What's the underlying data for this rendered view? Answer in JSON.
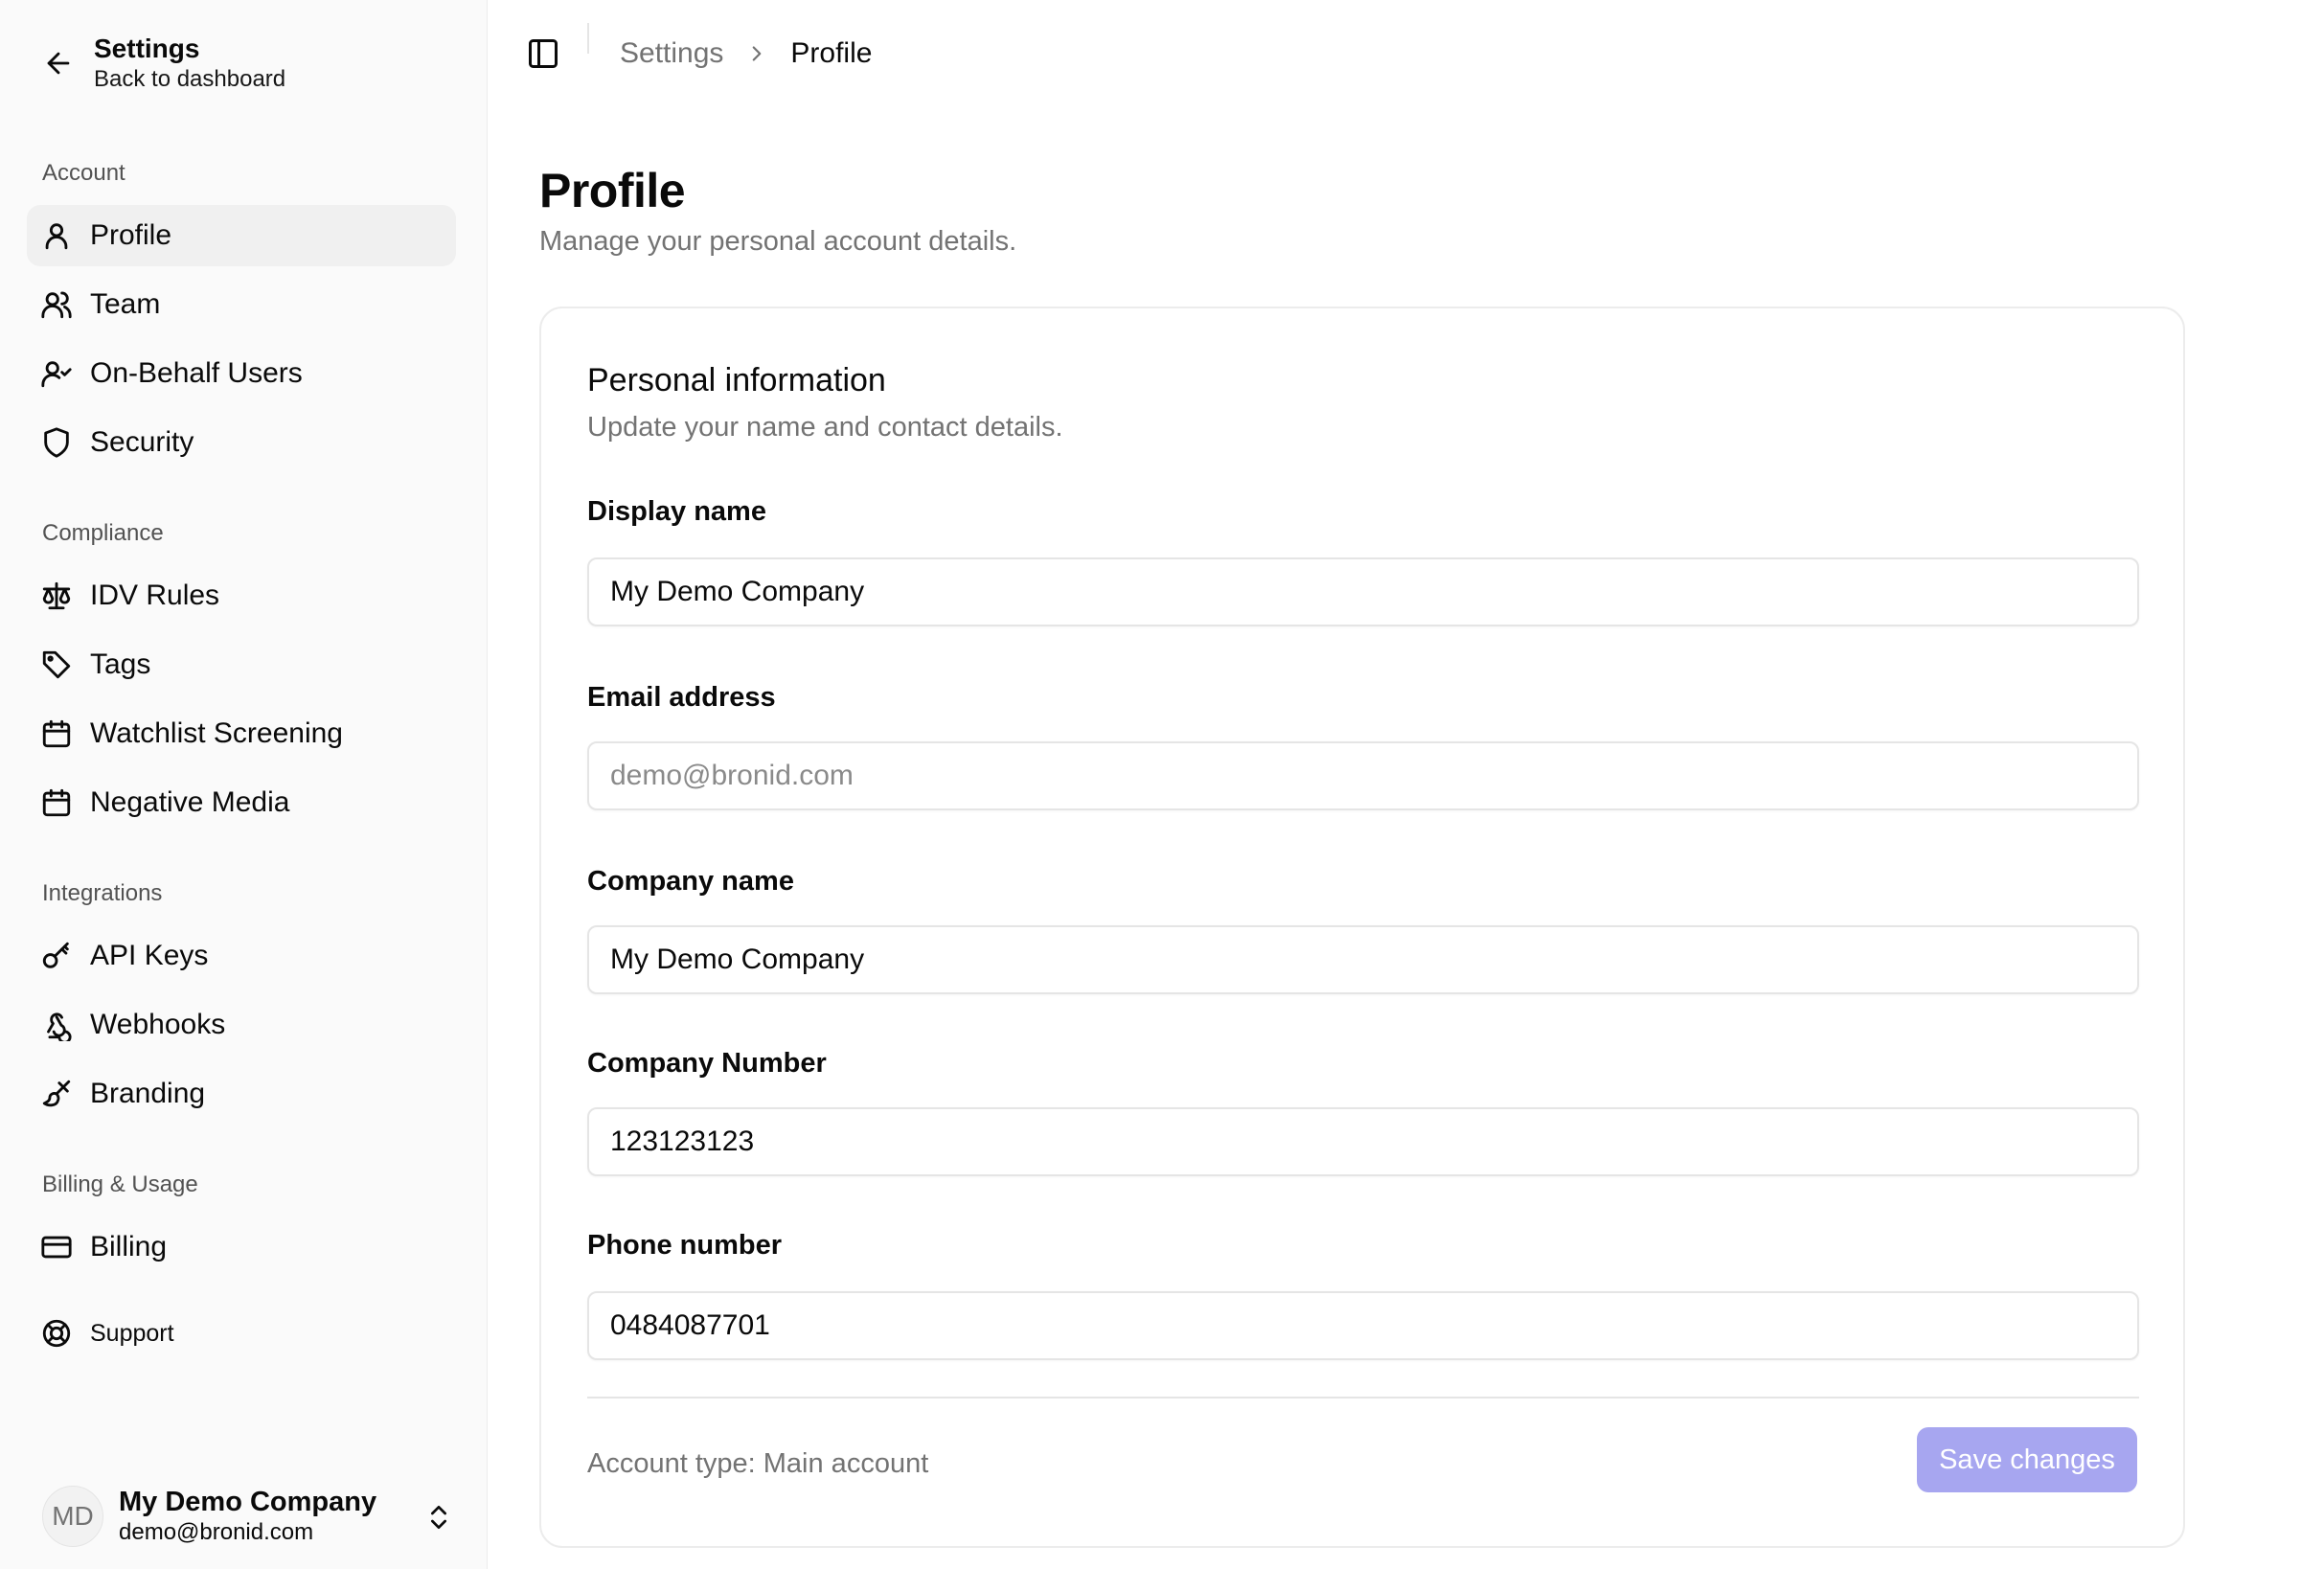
{
  "back": {
    "title": "Settings",
    "subtitle": "Back to dashboard"
  },
  "sidebar": {
    "groups": [
      {
        "label": "Account",
        "items": [
          {
            "label": "Profile",
            "icon": "user-icon"
          },
          {
            "label": "Team",
            "icon": "users-icon"
          },
          {
            "label": "On-Behalf Users",
            "icon": "user-check-icon"
          },
          {
            "label": "Security",
            "icon": "shield-icon"
          }
        ]
      },
      {
        "label": "Compliance",
        "items": [
          {
            "label": "IDV Rules",
            "icon": "scale-icon"
          },
          {
            "label": "Tags",
            "icon": "tag-icon"
          },
          {
            "label": "Watchlist Screening",
            "icon": "calendar-icon"
          },
          {
            "label": "Negative Media",
            "icon": "calendar-icon"
          }
        ]
      },
      {
        "label": "Integrations",
        "items": [
          {
            "label": "API Keys",
            "icon": "key-icon"
          },
          {
            "label": "Webhooks",
            "icon": "webhook-icon"
          },
          {
            "label": "Branding",
            "icon": "paintbrush-icon"
          }
        ]
      },
      {
        "label": "Billing & Usage",
        "items": [
          {
            "label": "Billing",
            "icon": "credit-card-icon"
          }
        ]
      }
    ],
    "support": {
      "label": "Support",
      "icon": "life-buoy-icon"
    },
    "active_item": "Profile"
  },
  "user": {
    "initials": "MD",
    "name": "My Demo Company",
    "email": "demo@bronid.com"
  },
  "breadcrumb": {
    "parent": "Settings",
    "current": "Profile"
  },
  "page": {
    "title": "Profile",
    "subtitle": "Manage your personal account details."
  },
  "card": {
    "title": "Personal information",
    "subtitle": "Update your name and contact details.",
    "fields": {
      "display_name": {
        "label": "Display name",
        "value": "My Demo Company"
      },
      "email": {
        "label": "Email address",
        "placeholder": "demo@bronid.com"
      },
      "company_name": {
        "label": "Company name",
        "value": "My Demo Company"
      },
      "company_number": {
        "label": "Company Number",
        "value": "123123123"
      },
      "phone": {
        "label": "Phone number",
        "value": "0484087701"
      }
    },
    "account_type": "Account type: Main account",
    "save_label": "Save changes"
  },
  "colors": {
    "accent_disabled": "#a7a6f0",
    "muted_text": "#737373",
    "active_bg": "#f0f0f0"
  }
}
